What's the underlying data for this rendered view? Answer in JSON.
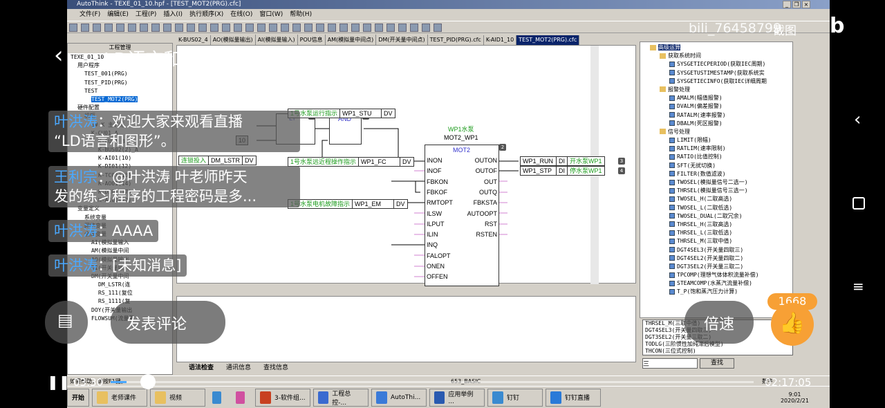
{
  "app": {
    "title": "AutoThink - TEXE_01_10.hpf - [TEST_MOT2(PRG).cfc]",
    "menu": [
      "文件(F)",
      "编辑(E)",
      "工程(P)",
      "插入(I)",
      "执行顺序(X)",
      "在线(O)",
      "窗口(W)",
      "帮助(H)"
    ],
    "left_panel_title": "工程管理",
    "project_tree": [
      "TEXE_01_10",
      "用户程序",
      "TEST_001(PRG)",
      "TEST_PID(PRG)",
      "TEST",
      "TEST_MOT2(PRG)",
      "硬件配置",
      "机柜",
      "1# K 主机柜",
      "K-CU01_A",
      "K-CU01_B",
      "K-BUS02(2)_A",
      "K-AI01(10)",
      "K-DI01(12)",
      "K-TC01(13)",
      "K-AO01(14)",
      "K-DI01(17)",
      "K-AI01(22)",
      "变量定义",
      "系统变量",
      "网络变量",
      "全局变量",
      "AI(模拟量输入",
      "AM(模拟量中间",
      "AO(模拟量输出",
      "DI(开关量输入",
      "DM(开关量中间",
      "DM_LSTR(连",
      "RS_111(复位",
      "RS_1111(复",
      "DOY(开关量输出",
      "FLOWSUM(流量累"
    ],
    "tabs": [
      "K-BUS02_4",
      "AO(模拟量输出)",
      "AI(模拟量输入)",
      "POU信息",
      "AM(模拟量中间点)",
      "DM(开关量中间点)",
      "TEST_PID(PRG).cfc",
      "K-AID1_10",
      "TEST_MOT2(PRG).cfc"
    ],
    "active_tab": 8,
    "diagram": {
      "lt": {
        "label": "LT",
        "order": "0",
        "const": "10"
      },
      "and": {
        "label": "AND",
        "order": "1"
      },
      "interlock": {
        "desc": "连锁投入",
        "name": "DM_LSTR",
        "type": "DV"
      },
      "mot": {
        "comment": "WP1水泵",
        "instance": "MOT2_WP1",
        "type": "MOT2",
        "order": "2",
        "inputs": [
          "INON",
          "INOF",
          "FBKON",
          "FBKOF",
          "RMTOPT",
          "ILSW",
          "ILPUT",
          "ILIN",
          "INQ",
          "FALOPT",
          "ONEN",
          "OFFEN"
        ],
        "outputs": [
          "OUTON",
          "OUTOF",
          "OUT",
          "OUTQ",
          "FBKSTA",
          "AUTOOPT",
          "RST",
          "RSTEN"
        ]
      },
      "in_vars": [
        {
          "desc": "1号水泵运行指示",
          "name": "WP1_STU",
          "type": "DV"
        },
        {
          "desc": "1号水泵远近程操作指示",
          "name": "WP1_FC",
          "type": "DV"
        },
        {
          "desc": "1号水泵电机故障指示",
          "name": "WP1_EM",
          "type": "DV"
        }
      ],
      "out_vars": [
        {
          "name": "WP1_RUN",
          "type": "DI",
          "desc": "开水泵WP1",
          "order": "3"
        },
        {
          "name": "WP1_STP",
          "type": "DI",
          "desc": "停水泵WP1",
          "order": "4"
        }
      ]
    },
    "bottom_tabs": [
      "语法检查",
      "通讯信息",
      "查找信息"
    ],
    "lib_tree": [
      {
        "t": "高级运算",
        "lvl": 0,
        "f": 1,
        "sel": 1
      },
      {
        "t": "获取系统时间",
        "lvl": 1,
        "f": 1
      },
      {
        "t": "SYSGETIECPERIOD(获取IEC周期)",
        "lvl": 2
      },
      {
        "t": "SYSGETUSTIMESTAMP(获取系统实",
        "lvl": 2
      },
      {
        "t": "SYSGETIECINFO(获取IEC详细周期",
        "lvl": 2
      },
      {
        "t": "报警处理",
        "lvl": 1,
        "f": 1
      },
      {
        "t": "AMALM(幅值报警)",
        "lvl": 2
      },
      {
        "t": "DVALM(偏差报警)",
        "lvl": 2
      },
      {
        "t": "RATALM(速率报警)",
        "lvl": 2
      },
      {
        "t": "DBALM(死区报警)",
        "lvl": 2
      },
      {
        "t": "信号处理",
        "lvl": 1,
        "f": 1
      },
      {
        "t": "LIMIT(限幅)",
        "lvl": 2
      },
      {
        "t": "RATLIM(速率限制)",
        "lvl": 2
      },
      {
        "t": "RATIO(比值控制)",
        "lvl": 2
      },
      {
        "t": "SFT(无扰切换)",
        "lvl": 2
      },
      {
        "t": "FILTER(数值滤波)",
        "lvl": 2
      },
      {
        "t": "TWOSEL(模拟量信号二选一)",
        "lvl": 2
      },
      {
        "t": "THRSEL(模拟量信号三选一)",
        "lvl": 2
      },
      {
        "t": "TWOSEL_H(二取高选)",
        "lvl": 2
      },
      {
        "t": "TWOSEL_L(二取低选)",
        "lvl": 2
      },
      {
        "t": "TWOSEL_DUAL(二取冗余)",
        "lvl": 2
      },
      {
        "t": "THRSEL_H(三取高选)",
        "lvl": 2
      },
      {
        "t": "THRSEL_L(三取低选)",
        "lvl": 2
      },
      {
        "t": "THRSEL_M(三取中值)",
        "lvl": 2
      },
      {
        "t": "DGT4SEL3(开关量四取三)",
        "lvl": 2
      },
      {
        "t": "DGT4SEL2(开关量四取二)",
        "lvl": 2
      },
      {
        "t": "DGT3SEL2(开关量三取二)",
        "lvl": 2
      },
      {
        "t": "TPCOMP(理想气体体积流量补偿)",
        "lvl": 2
      },
      {
        "t": "STEAMCOMP(水蒸汽流量补偿)",
        "lvl": 2
      },
      {
        "t": "T_P(饱和蒸汽压力计算)",
        "lvl": 2
      }
    ],
    "search_results": [
      "THRSEL_M(三取中值)",
      "DGT4SEL3(开关量四取三)",
      "DGT3SEL2(开关量三取二)",
      "TODLG(三阶惯性加纯滞后模型)",
      "THCON(三位式控制)"
    ],
    "search_value": "三",
    "search_button": "查找",
    "status_help": "如需帮助，请按F1键。",
    "status_mode": "653_BASIC",
    "status_num": "数字",
    "taskbar": {
      "start": "开始",
      "items": [
        "老师课件",
        "视频",
        "",
        "",
        "3-软件组...",
        "工程总控-...",
        "AutoThi...",
        "应用举例 ...",
        "钉钉",
        "钉钉直播"
      ],
      "time": "9:01",
      "date": "2020/2/21"
    }
  },
  "player": {
    "title": "LD语言和图形",
    "watermark": "bili_76458799",
    "screenshot_label": "截图",
    "danmaku": [
      {
        "user": "叶洪涛",
        "text": "欢迎大家来观看直播",
        "text2": "“LD语言和图形”。"
      },
      {
        "user": "王利宗",
        "text": "@叶洪涛 叶老师昨天",
        "text2": "发的练习程序的工程密码是多..."
      },
      {
        "user": "叶洪涛",
        "text": "AAAA"
      },
      {
        "user": "叶洪涛",
        "text": "[未知消息]"
      }
    ],
    "comment_placeholder": "发表评论",
    "speed_label": "倍速",
    "like_count": "1668",
    "current_time": "03:30",
    "total_time": "02:17:05",
    "progress": 0.025
  }
}
